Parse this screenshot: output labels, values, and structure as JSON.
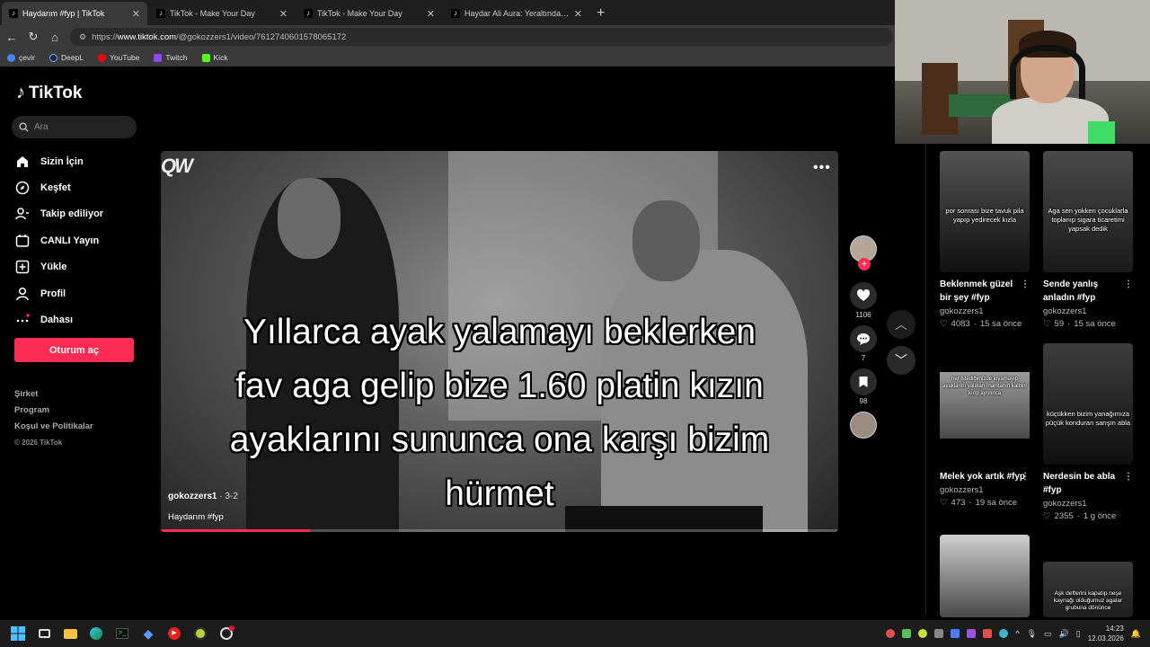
{
  "browser": {
    "tabs": [
      {
        "title": "Haydarım #fyp | TikTok",
        "active": true
      },
      {
        "title": "TikTok - Make Your Day",
        "active": false
      },
      {
        "title": "TikTok - Make Your Day",
        "active": false
      },
      {
        "title": "Haydar Ali Aura: Yeraltından Notla",
        "active": false
      }
    ],
    "url_prefix": "https://",
    "url_host": "www.tiktok.com",
    "url_path": "/@gokozzers1/video/7612740601578065172",
    "bookmarks": [
      {
        "label": "çevir",
        "color": "#4285f4"
      },
      {
        "label": "DeepL",
        "color": "#0f2b46"
      },
      {
        "label": "YouTube",
        "color": "#ff0000"
      },
      {
        "label": "Twitch",
        "color": "#9146ff"
      },
      {
        "label": "Kick",
        "color": "#53fc18"
      }
    ]
  },
  "tiktok": {
    "logo": "TikTok",
    "search_placeholder": "Ara",
    "nav": [
      {
        "label": "Sizin İçin",
        "icon": "home-icon"
      },
      {
        "label": "Keşfet",
        "icon": "compass-icon"
      },
      {
        "label": "Takip ediliyor",
        "icon": "following-icon"
      },
      {
        "label": "CANLI Yayın",
        "icon": "live-icon"
      },
      {
        "label": "Yükle",
        "icon": "upload-icon"
      },
      {
        "label": "Profil",
        "icon": "profile-icon"
      },
      {
        "label": "Dahası",
        "icon": "more-icon"
      }
    ],
    "login": "Oturum aç",
    "footer": {
      "company": "Şirket",
      "program": "Program",
      "terms": "Koşul ve Politikalar",
      "copyright": "© 2026 TikTok"
    },
    "accent": "#fe2c55"
  },
  "video": {
    "watermark": "QW",
    "caption_lines": [
      "Yıllarca ayak yalamayı beklerken",
      "fav aga gelip bize 1.60 platin kızın",
      "ayaklarını sununca ona karşı bizim",
      "hürmet"
    ],
    "username": "gokozzers1",
    "date": "· 3-2",
    "description": "Haydarım #fyp",
    "progress": 0.22,
    "likes": "1106",
    "comments": "7",
    "saves": "98"
  },
  "recommended": [
    {
      "overlay": "por sonrası bize tavuk pila yapıp yedirecek kızla",
      "title": "Beklenmek güzel bir şey #fyp",
      "user": "gokozzers1",
      "likes": "4083",
      "age": "15 sa önce"
    },
    {
      "overlay": "Aga sen yokken çocuklarla toplanıp sigara ticaretimi yapsak dedik",
      "title": "Sende yanlış anladın #fyp",
      "user": "gokozzers1",
      "likes": "59",
      "age": "15 sa önce"
    },
    {
      "overlay": "her istediğimizde kıyamayıp ayaklarını yalatan manitanın kalbini kırıp ayrılınca",
      "title": "Melek yok artık #fyp",
      "user": "gokozzers1",
      "likes": "473",
      "age": "19 sa önce"
    },
    {
      "overlay": "küçükken bizim yanağımıza püçük konduran sarışın abla",
      "title": "Nerdesin be abla #fyp",
      "user": "gokozzers1",
      "likes": "2355",
      "age": "1 g önce"
    },
    {
      "overlay": "",
      "title": "",
      "user": "",
      "likes": "",
      "age": ""
    },
    {
      "overlay": "Aşk defterini kapatıp neşe kaynağı olduğumuz agalar grubuna dönünce",
      "title": "",
      "user": "",
      "likes": "",
      "age": ""
    }
  ],
  "taskbar": {
    "time": "14:23",
    "date": "12.03.2026"
  }
}
